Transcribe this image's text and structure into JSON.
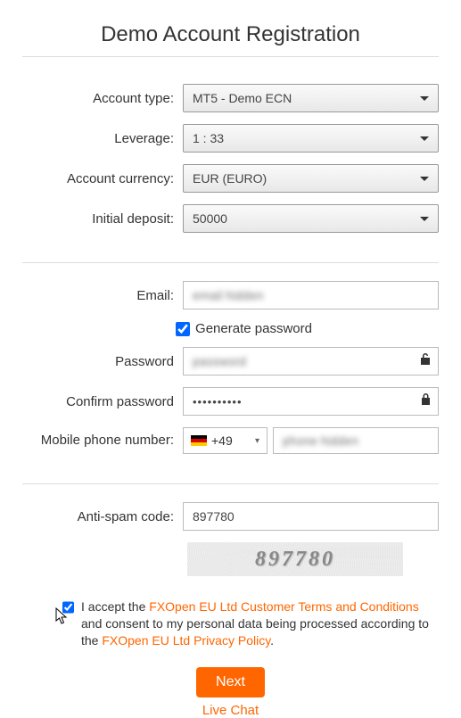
{
  "title": "Demo Account Registration",
  "labels": {
    "account_type": "Account type:",
    "leverage": "Leverage:",
    "account_currency": "Account currency:",
    "initial_deposit": "Initial deposit:",
    "email": "Email:",
    "generate_password": "Generate password",
    "password": "Password",
    "confirm_password": "Confirm password",
    "mobile_phone": "Mobile phone number:",
    "anti_spam": "Anti-spam code:"
  },
  "values": {
    "account_type": "MT5 - Demo ECN",
    "leverage": "1 : 33",
    "account_currency": "EUR (EURO)",
    "initial_deposit": "50000",
    "email": "email hidden",
    "password": "password",
    "confirm_password": "••••••••••",
    "phone_prefix": "+49",
    "phone": "phone hidden",
    "captcha_input": "897780",
    "captcha_display": "897780"
  },
  "consent": {
    "pre": "I accept the ",
    "link1": "FXOpen EU Ltd Customer Terms and Conditions",
    "mid": " and consent to my personal data being processed according to the ",
    "link2": "FXOpen EU Ltd Privacy Policy",
    "end": "."
  },
  "buttons": {
    "next": "Next",
    "live_chat": "Live Chat"
  },
  "mini_chevron": "▾"
}
